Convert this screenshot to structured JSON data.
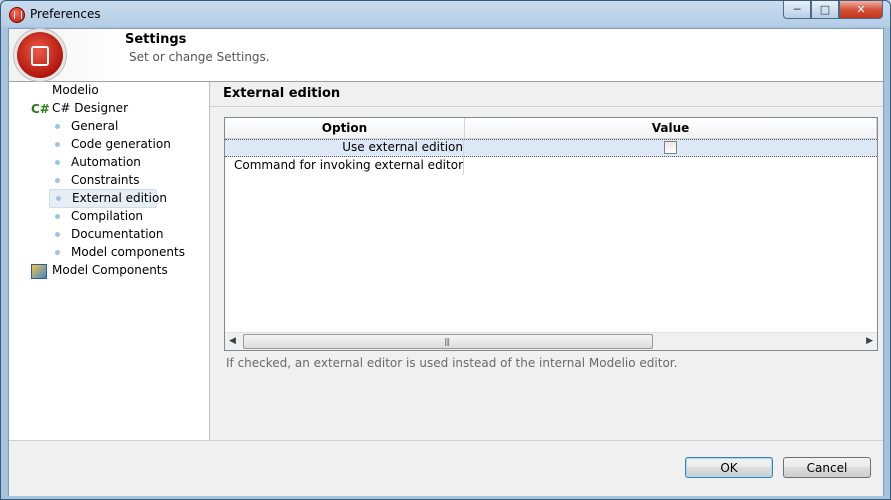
{
  "window": {
    "title": "Preferences"
  },
  "header": {
    "title": "Settings",
    "subtitle": "Set or change Settings."
  },
  "tree": {
    "items": [
      {
        "label": "Modelio",
        "level": 0
      },
      {
        "label": "C# Designer",
        "level": 0,
        "icon": "csharp-icon"
      },
      {
        "label": "General",
        "level": 1
      },
      {
        "label": "Code generation",
        "level": 1
      },
      {
        "label": "Automation",
        "level": 1
      },
      {
        "label": "Constraints",
        "level": 1
      },
      {
        "label": "External edition",
        "level": 1,
        "selected": true
      },
      {
        "label": "Compilation",
        "level": 1
      },
      {
        "label": "Documentation",
        "level": 1
      },
      {
        "label": "Model components",
        "level": 1
      },
      {
        "label": "Model Components",
        "level": 0,
        "icon": "model-components-icon"
      }
    ]
  },
  "panel": {
    "title": "External edition",
    "table": {
      "headers": {
        "option": "Option",
        "value": "Value"
      },
      "rows": [
        {
          "option": "Use external edition",
          "value_type": "checkbox",
          "checked": false
        },
        {
          "option": "Command for invoking external editor",
          "value": ""
        }
      ]
    },
    "help": "If checked, an external editor is used instead of the internal Modelio editor."
  },
  "footer": {
    "ok_label": "OK",
    "cancel_label": "Cancel"
  },
  "colors": {
    "accent": "#3c7fb1",
    "selection": "#dde9f6",
    "close_button": "#c2331b"
  }
}
